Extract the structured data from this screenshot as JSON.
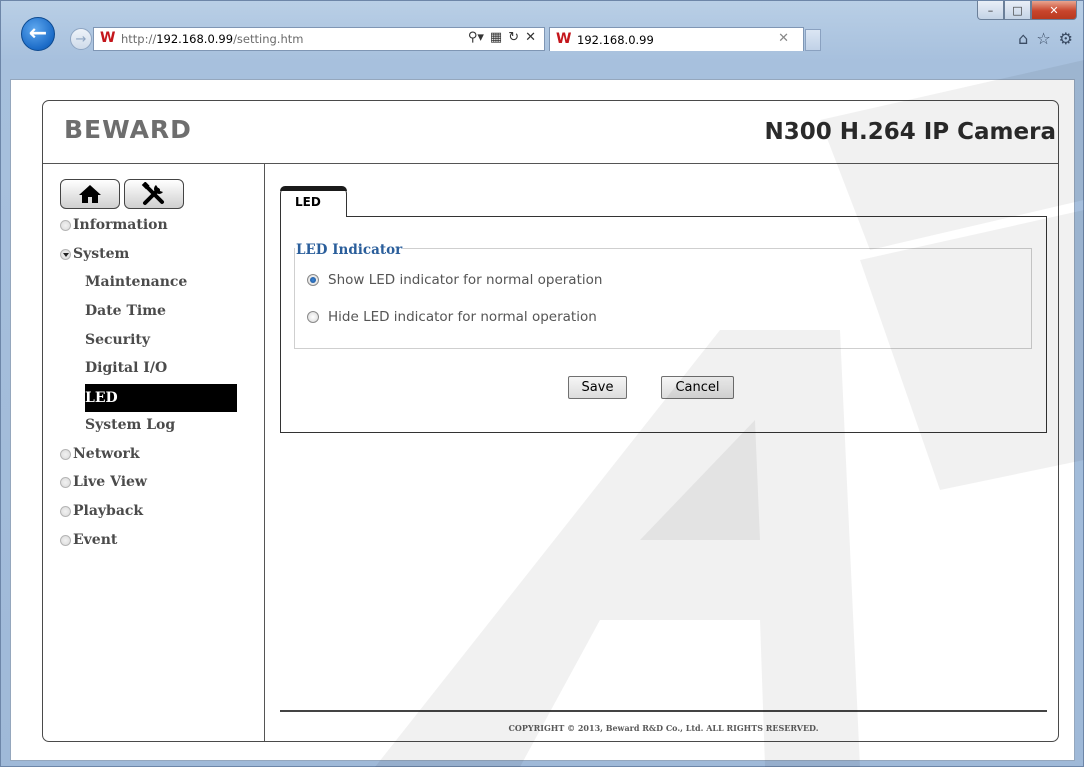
{
  "browser": {
    "address": {
      "prefix": "http://",
      "host": "192.168.0.99",
      "path": "/setting.htm"
    },
    "tab_title": "192.168.0.99",
    "window_controls": [
      "minimize",
      "maximize",
      "close"
    ]
  },
  "header": {
    "brand": "BEWARD",
    "product": "N300 H.264 IP Camera"
  },
  "sidebar": {
    "tools": [
      {
        "icon": "home-icon"
      },
      {
        "icon": "tools-icon"
      }
    ],
    "menu": [
      {
        "label": "Information",
        "state": "collapsed"
      },
      {
        "label": "System",
        "state": "expanded",
        "children": [
          {
            "label": "Maintenance"
          },
          {
            "label": "Date Time"
          },
          {
            "label": "Security"
          },
          {
            "label": "Digital I/O"
          },
          {
            "label": "LED",
            "active": true
          },
          {
            "label": "System Log"
          }
        ]
      },
      {
        "label": "Network",
        "state": "collapsed"
      },
      {
        "label": "Live View",
        "state": "collapsed"
      },
      {
        "label": "Playback",
        "state": "collapsed"
      },
      {
        "label": "Event",
        "state": "collapsed"
      }
    ]
  },
  "content": {
    "tab_label": "LED",
    "fieldset_legend": "LED Indicator",
    "options": [
      {
        "label": "Show LED indicator for normal operation",
        "checked": true
      },
      {
        "label": "Hide LED indicator for normal operation",
        "checked": false
      }
    ],
    "buttons": {
      "save": "Save",
      "cancel": "Cancel"
    },
    "copyright": "COPYRIGHT © 2013, Beward R&D Co., Ltd. ALL RIGHTS RESERVED."
  },
  "colors": {
    "legend": "#2a5e9b",
    "active_menu_bg": "#000000",
    "brand_gray": "#6e6e6e"
  }
}
